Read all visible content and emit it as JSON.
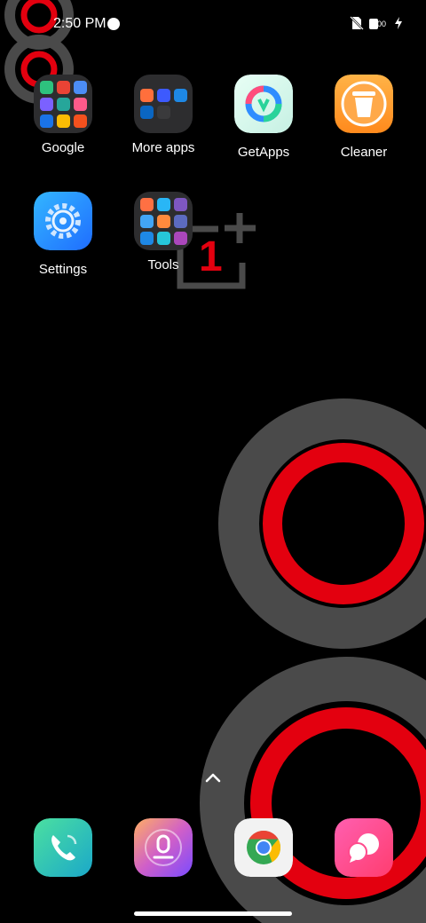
{
  "status_bar": {
    "time": "2:50 PM",
    "battery_text": "00",
    "icons": [
      "vpn-key-icon",
      "no-sim-icon",
      "battery-icon",
      "charging-bolt-icon"
    ]
  },
  "wallpaper": {
    "brand_text": "1",
    "accent": "#e3000f",
    "ring_gray": "#4a4a4a"
  },
  "apps": {
    "row1": [
      {
        "label": "Google",
        "kind": "folder"
      },
      {
        "label": "More apps",
        "kind": "folder"
      },
      {
        "label": "GetApps",
        "kind": "app"
      },
      {
        "label": "Cleaner",
        "kind": "app"
      }
    ],
    "row2": [
      {
        "label": "Settings",
        "kind": "app"
      },
      {
        "label": "Tools",
        "kind": "folder"
      }
    ]
  },
  "dock": [
    "phone-icon",
    "recorder-icon",
    "chrome-icon",
    "messages-icon"
  ],
  "colors": {
    "folder_bg": "#2d2d2f",
    "text": "#ffffff"
  }
}
